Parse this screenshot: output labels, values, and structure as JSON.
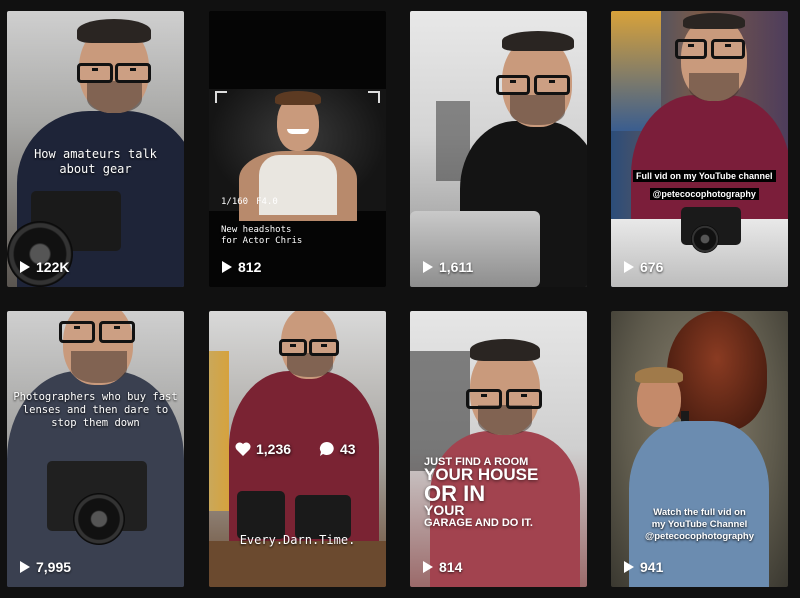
{
  "tiles": [
    {
      "caption": [
        "How amateurs talk",
        "about gear"
      ],
      "views": "122K"
    },
    {
      "caption": [
        "New headshots",
        "for Actor Chris"
      ],
      "views": "812",
      "hud": {
        "shutter": "1/160",
        "aperture": "F4.0"
      }
    },
    {
      "views": "1,611"
    },
    {
      "caption": [
        "Full vid on my YouTube channel",
        "@petecocophotography"
      ],
      "views": "676"
    },
    {
      "caption": [
        "Photographers who buy fast",
        "lenses and then dare to",
        "stop them down"
      ],
      "views": "7,995"
    },
    {
      "caption": [
        "Every.Darn.Time."
      ],
      "likes": "1,236",
      "comments": "43"
    },
    {
      "caption": [
        "JUST FIND A ROOM",
        "YOUR HOUSE",
        "OR IN",
        "YOUR",
        "GARAGE AND DO IT."
      ],
      "views": "814"
    },
    {
      "caption": [
        "Watch the full vid on",
        "my YouTube Channel",
        "@petecocophotography"
      ],
      "views": "941"
    }
  ],
  "icons": {
    "play": "play-icon",
    "heart": "heart-icon",
    "comment": "comment-icon"
  },
  "colors": {
    "background": "#111111",
    "text": "#ffffff"
  }
}
